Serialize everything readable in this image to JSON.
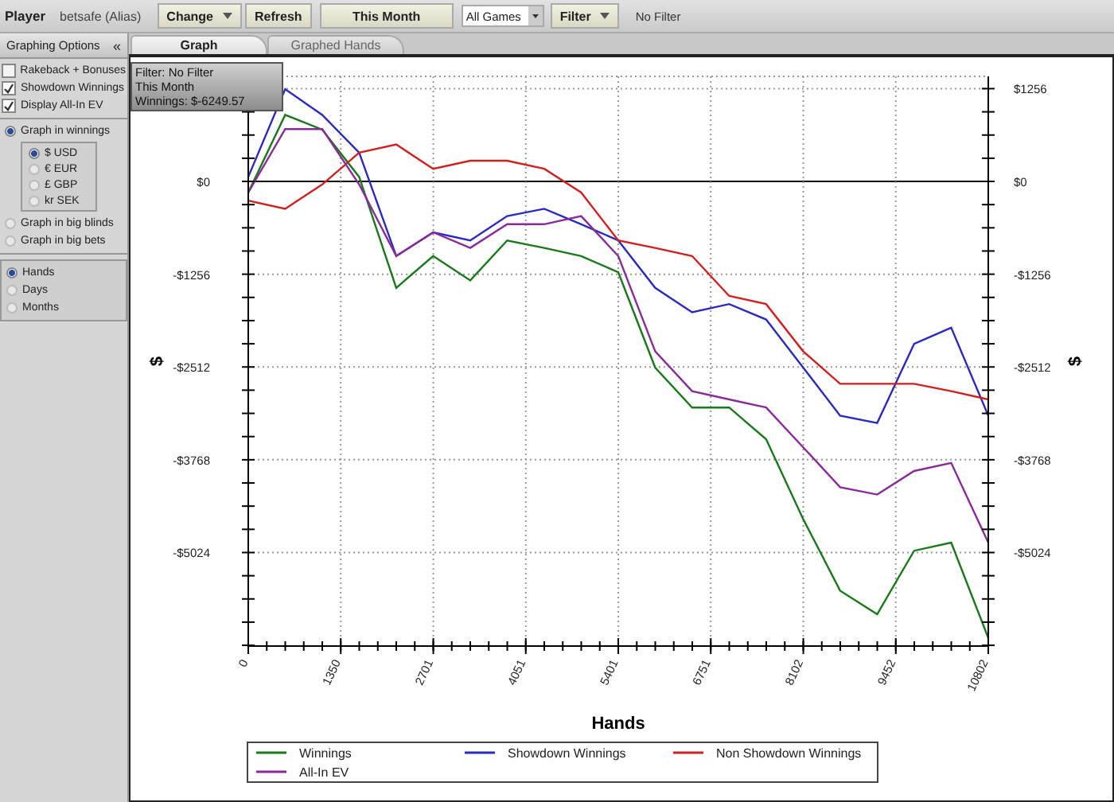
{
  "toolbar": {
    "player_label": "Player",
    "player_name": "betsafe (Alias)",
    "items": [
      {
        "kind": "button",
        "label": "Change",
        "dropdown": true
      },
      {
        "kind": "button",
        "label": "Refresh",
        "dropdown": false
      },
      {
        "kind": "wide",
        "label": "This Month",
        "dropdown": false
      },
      {
        "kind": "select",
        "label": "All Games",
        "dropdown": true
      },
      {
        "kind": "button",
        "label": "Filter",
        "dropdown": true
      }
    ],
    "filter_status": "No Filter"
  },
  "sidebar": {
    "header": "Graphing Options",
    "collapse_icon": "«",
    "checkboxes": [
      {
        "label": "Rakeback + Bonuses",
        "checked": false
      },
      {
        "label": "Showdown Winnings",
        "checked": true
      },
      {
        "label": "Display All-In EV",
        "checked": true
      }
    ],
    "graph_in": [
      {
        "label": "Graph in winnings",
        "selected": true
      },
      {
        "label": "Graph in big blinds",
        "selected": false
      },
      {
        "label": "Graph in big bets",
        "selected": false
      }
    ],
    "currencies": [
      {
        "label": "$ USD",
        "selected": true
      },
      {
        "label": "€ EUR",
        "selected": false
      },
      {
        "label": "£ GBP",
        "selected": false
      },
      {
        "label": "kr SEK",
        "selected": false
      }
    ],
    "x_units": [
      {
        "label": "Hands",
        "selected": true
      },
      {
        "label": "Days",
        "selected": false
      },
      {
        "label": "Months",
        "selected": false
      }
    ]
  },
  "tabs": [
    {
      "label": "Graph",
      "selected": true
    },
    {
      "label": "Graphed Hands",
      "selected": false
    }
  ],
  "info_box": [
    "Filter: No Filter",
    "This Month",
    "Winnings: $-6249.57"
  ],
  "chart": {
    "chart_data": {
      "type": "line",
      "xlabel": "Hands",
      "ylabel": "$",
      "grid": true,
      "legend": true,
      "x": [
        0,
        540,
        1080,
        1620,
        2160,
        2700,
        3240,
        3780,
        4320,
        4860,
        5400,
        5940,
        6480,
        7020,
        7560,
        8100,
        8640,
        9180,
        9720,
        10260,
        10802
      ],
      "xlim": [
        0,
        10802
      ],
      "ylim": [
        -6290,
        1422
      ],
      "xticks": [
        0,
        1350,
        2701,
        4051,
        5401,
        6751,
        8102,
        9452,
        10802
      ],
      "yticks": [
        {
          "value": 1256,
          "label": "$1256"
        },
        {
          "value": 0,
          "label": "$0"
        },
        {
          "value": -1256,
          "label": "-$1256"
        },
        {
          "value": -2512,
          "label": "-$2512"
        },
        {
          "value": -3768,
          "label": "-$3768"
        },
        {
          "value": -5024,
          "label": "-$5024"
        }
      ],
      "series": [
        {
          "name": "Winnings",
          "color": "#1a7a1a",
          "values": [
            -150,
            900,
            700,
            60,
            -1440,
            -1010,
            -1340,
            -800,
            -900,
            -1010,
            -1230,
            -2520,
            -3060,
            -3060,
            -3490,
            -4570,
            -5540,
            -5860,
            -5000,
            -4890,
            -6180
          ]
        },
        {
          "name": "Showdown Winnings",
          "color": "#2a2ac0",
          "values": [
            60,
            1250,
            900,
            390,
            -1010,
            -690,
            -800,
            -470,
            -370,
            -580,
            -800,
            -1440,
            -1770,
            -1660,
            -1870,
            -2520,
            -3170,
            -3270,
            -2200,
            -1980,
            -3170
          ]
        },
        {
          "name": "Non Showdown Winnings",
          "color": "#d02020",
          "values": [
            -260,
            -370,
            -40,
            390,
            500,
            170,
            280,
            280,
            170,
            -150,
            -800,
            -900,
            -1010,
            -1550,
            -1660,
            -2300,
            -2740,
            -2740,
            -2740,
            -2840,
            -2950
          ]
        },
        {
          "name": "All-In EV",
          "color": "#8a2a9a",
          "values": [
            -150,
            710,
            710,
            -40,
            -1010,
            -690,
            -900,
            -580,
            -580,
            -470,
            -1010,
            -2300,
            -2840,
            -2950,
            -3060,
            -3600,
            -4140,
            -4240,
            -3920,
            -3810,
            -4890
          ]
        }
      ]
    }
  }
}
